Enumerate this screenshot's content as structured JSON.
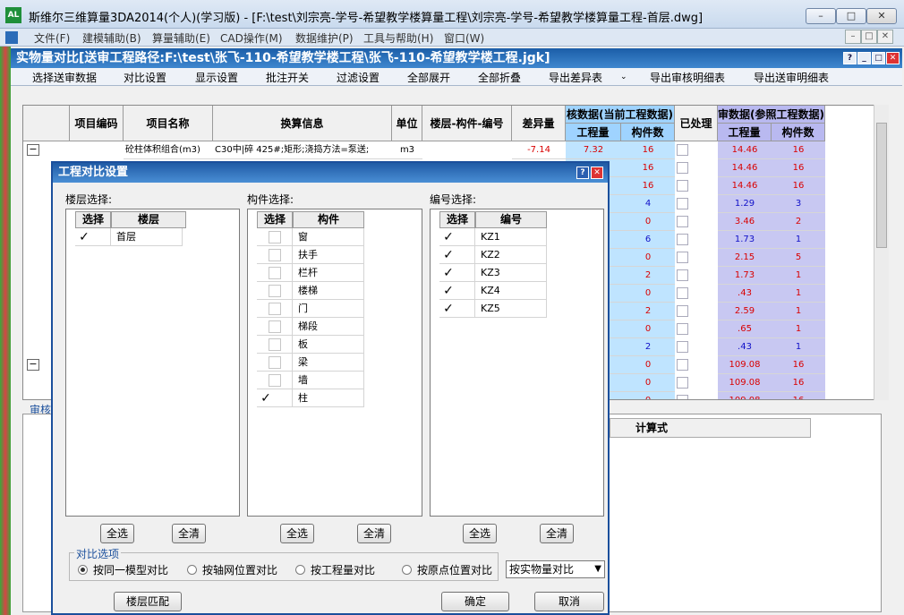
{
  "app": {
    "title": "斯维尔三维算量3DA2014(个人)(学习版) - [F:\\test\\刘宗亮-学号-希望教学楼算量工程\\刘宗亮-学号-希望教学楼算量工程-首层.dwg]",
    "icon_text": "AL",
    "controls": {
      "minimize": "–",
      "maximize": "□",
      "close": "✕"
    }
  },
  "menu": [
    "文件(F)",
    "建模辅助(B)",
    "算量辅助(E)",
    "CAD操作(M)",
    "数据维护(P)",
    "工具与帮助(H)",
    "窗口(W)"
  ],
  "inner_window": {
    "title": "实物量对比[送审工程路径:F:\\test\\张飞-110-希望教学楼工程\\张飞-110-希望教学楼工程.jgk]",
    "controls": {
      "help": "?",
      "minimize": "_",
      "restore": "□",
      "close": "✕"
    }
  },
  "toolbar": [
    "选择送审数据",
    "对比设置",
    "显示设置",
    "批注开关",
    "过滤设置",
    "全部展开",
    "全部折叠",
    "导出差异表",
    "导出审核明细表",
    "导出送审明细表"
  ],
  "grid": {
    "headers": {
      "code": "项目编码",
      "name": "项目名称",
      "calc": "换算信息",
      "unit": "单位",
      "floor_member": "楼层-构件-编号",
      "diff": "差异量",
      "check_group": "核数据(当前工程数据)",
      "check_qty": "工程量",
      "check_count": "构件数",
      "processed": "已处理",
      "review_group": "审数据(参照工程数据)",
      "review_qty": "工程量",
      "review_count": "构件数"
    },
    "first_row": {
      "name": "砼柱体积组合(m3)",
      "calc": "C30中|碎 425#;矩形;浇捣方法=泵送;",
      "unit": "m3",
      "diff": "-7.14"
    },
    "rows": [
      {
        "check_qty": "7.32",
        "check_count": "16",
        "review_qty": "14.46",
        "review_count": "16",
        "color": "red"
      },
      {
        "check_qty": "",
        "check_count": "16",
        "review_qty": "14.46",
        "review_count": "16",
        "color": "red"
      },
      {
        "check_qty": "",
        "check_count": "16",
        "review_qty": "14.46",
        "review_count": "16",
        "color": "red"
      },
      {
        "check_qty": "",
        "check_count": "4",
        "review_qty": "1.29",
        "review_count": "3",
        "color": "blue"
      },
      {
        "check_qty": "",
        "check_count": "0",
        "review_qty": "3.46",
        "review_count": "2",
        "color": "red"
      },
      {
        "check_qty": "",
        "check_count": "6",
        "review_qty": "1.73",
        "review_count": "1",
        "color": "blue"
      },
      {
        "check_qty": "",
        "check_count": "0",
        "review_qty": "2.15",
        "review_count": "5",
        "color": "red"
      },
      {
        "check_qty": "",
        "check_count": "2",
        "review_qty": "1.73",
        "review_count": "1",
        "color": "red"
      },
      {
        "check_qty": "",
        "check_count": "0",
        "review_qty": ".43",
        "review_count": "1",
        "color": "red"
      },
      {
        "check_qty": "",
        "check_count": "2",
        "review_qty": "2.59",
        "review_count": "1",
        "color": "red"
      },
      {
        "check_qty": "",
        "check_count": "0",
        "review_qty": ".65",
        "review_count": "1",
        "color": "red"
      },
      {
        "check_qty": "",
        "check_count": "2",
        "review_qty": ".43",
        "review_count": "1",
        "color": "blue"
      },
      {
        "check_qty": "",
        "check_count": "0",
        "review_qty": "109.08",
        "review_count": "16",
        "color": "red"
      },
      {
        "check_qty": "",
        "check_count": "0",
        "review_qty": "109.08",
        "review_count": "16",
        "color": "red"
      },
      {
        "check_qty": "",
        "check_count": "0",
        "review_qty": "109.08",
        "review_count": "16",
        "color": "red"
      }
    ],
    "tree_toggles": [
      "−",
      "−",
      "−",
      "−"
    ]
  },
  "lower_panel": {
    "tab_label": "审核",
    "header_calc": "计算式"
  },
  "dialog": {
    "title": "工程对比设置",
    "controls": {
      "help": "?",
      "close": "✕"
    },
    "floor_section_label": "楼层选择:",
    "member_section_label": "构件选择:",
    "code_section_label": "编号选择:",
    "col_select": "选择",
    "col_floor": "楼层",
    "col_member": "构件",
    "col_code": "编号",
    "floors": [
      {
        "name": "首层",
        "checked": true
      }
    ],
    "members": [
      {
        "name": "窗",
        "checked": false
      },
      {
        "name": "扶手",
        "checked": false
      },
      {
        "name": "栏杆",
        "checked": false
      },
      {
        "name": "楼梯",
        "checked": false
      },
      {
        "name": "门",
        "checked": false
      },
      {
        "name": "梯段",
        "checked": false
      },
      {
        "name": "板",
        "checked": false
      },
      {
        "name": "梁",
        "checked": false
      },
      {
        "name": "墙",
        "checked": false
      },
      {
        "name": "柱",
        "checked": true
      }
    ],
    "codes": [
      {
        "name": "KZ1",
        "checked": true
      },
      {
        "name": "KZ2",
        "checked": true
      },
      {
        "name": "KZ3",
        "checked": true
      },
      {
        "name": "KZ4",
        "checked": true
      },
      {
        "name": "KZ5",
        "checked": true
      }
    ],
    "select_all": "全选",
    "clear_all": "全清",
    "options_legend": "对比选项",
    "options": [
      "按同一模型对比",
      "按轴网位置对比",
      "按工程量对比",
      "按原点位置对比"
    ],
    "selected_option": 0,
    "dropdown_value": "按实物量对比",
    "floor_match": "楼层匹配",
    "ok": "确定",
    "cancel": "取消",
    "check_mark": "✓"
  }
}
